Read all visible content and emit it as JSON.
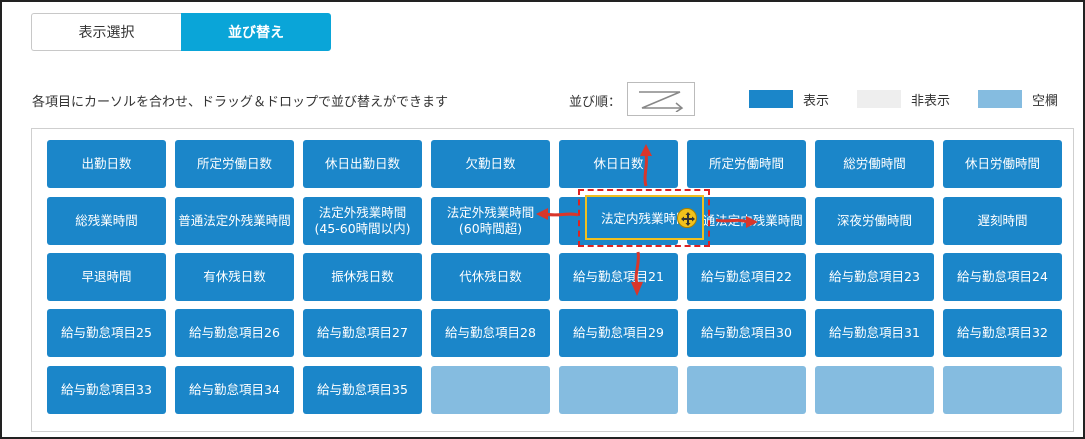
{
  "tabs": [
    {
      "label": "表示選択",
      "active": false
    },
    {
      "label": "並び替え",
      "active": true
    }
  ],
  "instruction": "各項目にカーソルを合わせ、ドラッグ＆ドロップで並び替えができます",
  "order_label": "並び順：",
  "legend": [
    {
      "label": "表示",
      "color": "#1b86c9"
    },
    {
      "label": "非表示",
      "color": "#eeeeee"
    },
    {
      "label": "空欄",
      "color": "#85bce0"
    }
  ],
  "items": [
    [
      "出勤日数",
      "所定労働日数",
      "休日出勤日数",
      "欠勤日数",
      "休日日数",
      "所定労働時間",
      "総労働時間",
      "休日労働時間"
    ],
    [
      "総残業時間",
      "普通法定外残業時間",
      "法定外残業時間\n(45-60時間以内)",
      "法定外残業時間\n(60時間超)",
      "",
      "普通法定内残業時間",
      "深夜労働時間",
      "遅刻時間"
    ],
    [
      "早退時間",
      "有休残日数",
      "振休残日数",
      "代休残日数",
      "給与勤怠項目21",
      "給与勤怠項目22",
      "給与勤怠項目23",
      "給与勤怠項目24"
    ],
    [
      "給与勤怠項目25",
      "給与勤怠項目26",
      "給与勤怠項目27",
      "給与勤怠項目28",
      "給与勤怠項目29",
      "給与勤怠項目30",
      "給与勤怠項目31",
      "給与勤怠項目32"
    ],
    [
      "給与勤怠項目33",
      "給与勤怠項目34",
      "給与勤怠項目35",
      "",
      "",
      "",
      "",
      ""
    ]
  ],
  "dragging_item": "法定内残業時間",
  "colors": {
    "accent": "#0aa5d8",
    "item": "#1b86c9",
    "empty": "#85bce0",
    "arrow": "#d9362b"
  }
}
